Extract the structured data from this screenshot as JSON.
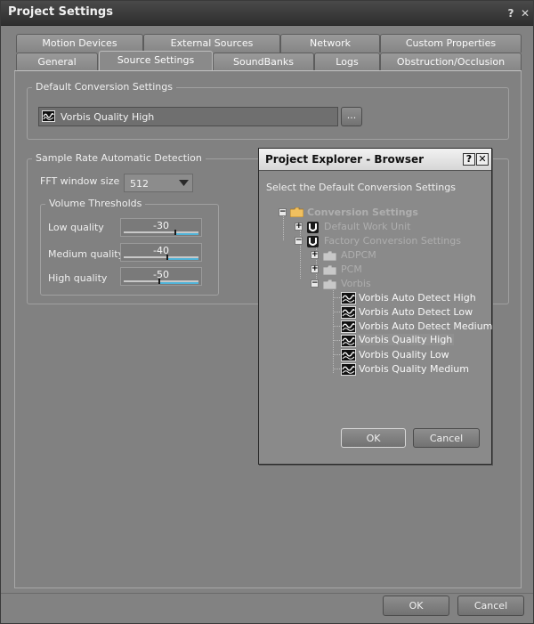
{
  "window": {
    "title": "Project Settings",
    "help": "?",
    "close": "✕"
  },
  "tabs_row1": [
    "Motion Devices",
    "External Sources",
    "Network",
    "Custom Properties"
  ],
  "tabs_row2": [
    "General",
    "Source Settings",
    "SoundBanks",
    "Logs",
    "Obstruction/Occlusion"
  ],
  "active_tab": "Source Settings",
  "default_conversion": {
    "group_label": "Default Conversion Settings",
    "value": "Vorbis Quality High",
    "browse_label": "..."
  },
  "sample_rate": {
    "group_label": "Sample Rate Automatic Detection",
    "fft_label": "FFT window size",
    "fft_value": "512",
    "thresholds_label": "Volume Thresholds",
    "rows": [
      {
        "label": "Low quality",
        "value": "-30",
        "level": 0.68
      },
      {
        "label": "Medium quality",
        "value": "-40",
        "level": 0.57
      },
      {
        "label": "High quality",
        "value": "-50",
        "level": 0.46
      }
    ]
  },
  "footer": {
    "ok": "OK",
    "cancel": "Cancel"
  },
  "browser": {
    "title": "Project Explorer - Browser",
    "help": "?",
    "close": "✕",
    "instruction": "Select the Default Conversion Settings",
    "tree": {
      "root": "Conversion Settings",
      "default_work_unit": "Default Work Unit",
      "factory": "Factory Conversion Settings",
      "adpcm": "ADPCM",
      "pcm": "PCM",
      "vorbis": "Vorbis",
      "items": [
        "Vorbis Auto Detect High",
        "Vorbis Auto Detect Low",
        "Vorbis Auto Detect Medium",
        "Vorbis Quality High",
        "Vorbis Quality Low",
        "Vorbis Quality Medium"
      ],
      "selected": "Vorbis Quality High"
    },
    "ok": "OK",
    "cancel": "Cancel"
  },
  "colors": {
    "accent": "#4fb3d8",
    "folder": "#f0c060"
  }
}
